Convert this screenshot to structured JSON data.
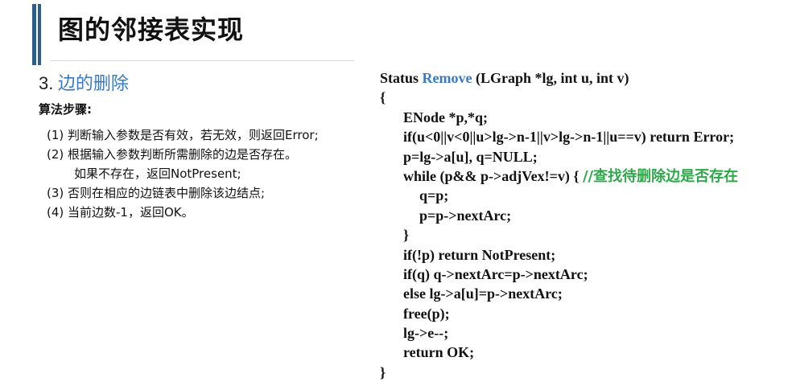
{
  "slide": {
    "title": "图的邻接表实现"
  },
  "section": {
    "number": "3.",
    "name": "边的删除"
  },
  "algorithm": {
    "label": "算法步骤:",
    "steps": [
      "(1) 判断输入参数是否有效，若无效，则返回Error;",
      "(2) 根据输入参数判断所需删除的边是否存在。",
      "如果不存在，返回NotPresent;",
      "(3) 否则在相应的边链表中删除该边结点;",
      "(4) 当前边数-1，返回OK。"
    ]
  },
  "code": {
    "header_prefix": "Status ",
    "header_fn": "Remove",
    "header_suffix": " (LGraph *lg, int u, int v)",
    "open_brace": "{",
    "lines": [
      "ENode *p,*q;",
      "if(u<0||v<0||u>lg->n-1||v>lg->n-1||u==v)   return Error;",
      "p=lg->a[u], q=NULL;",
      "while (p&& p->adjVex!=v) { ",
      "q=p;",
      "p=p->nextArc;",
      "}",
      "if(!p) return NotPresent;",
      "if(q) q->nextArc=p->nextArc;",
      "else lg->a[u]=p->nextArc;",
      "free(p);",
      "lg->e--;",
      "return OK;"
    ],
    "comment": "//查找待删除边是否存在",
    "close_brace": "}"
  },
  "colors": {
    "accent_bar": "#2e5d8c",
    "heading_blue": "#3a78c3",
    "comment_green": "#2ea84a"
  }
}
